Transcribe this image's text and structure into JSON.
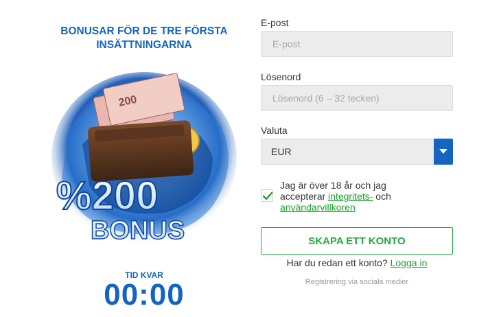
{
  "promo": {
    "title_line1": "BONUSAR FÖR DE TRE FÖRSTA",
    "title_line2": "INSÄTTNINGARNA",
    "art_text_main": "%200",
    "art_text_sub": "BONUS",
    "timer_label": "TID KVAR",
    "timer_value": "00:00"
  },
  "form": {
    "email_label": "E-post",
    "email_placeholder": "E-post",
    "email_value": "",
    "password_label": "Lösenord",
    "password_placeholder": "Lösenord (6 – 32 tecken)",
    "password_value": "",
    "currency_label": "Valuta",
    "currency_selected": "EUR",
    "terms_checked": true,
    "terms_text_1": "Jag är över 18 år och jag accepterar ",
    "terms_link_1": "integritets-",
    "terms_text_2": " och ",
    "terms_link_2": "användarvillkoren",
    "submit_label": "SKAPA ETT KONTO",
    "have_account_text": "Har du redan ett konto? ",
    "login_link": "Logga in",
    "social_text": "Registrering via sociala medier"
  },
  "colors": {
    "brand_blue": "#1565c0",
    "accent_green": "#24a844",
    "field_bg": "#ececec"
  }
}
